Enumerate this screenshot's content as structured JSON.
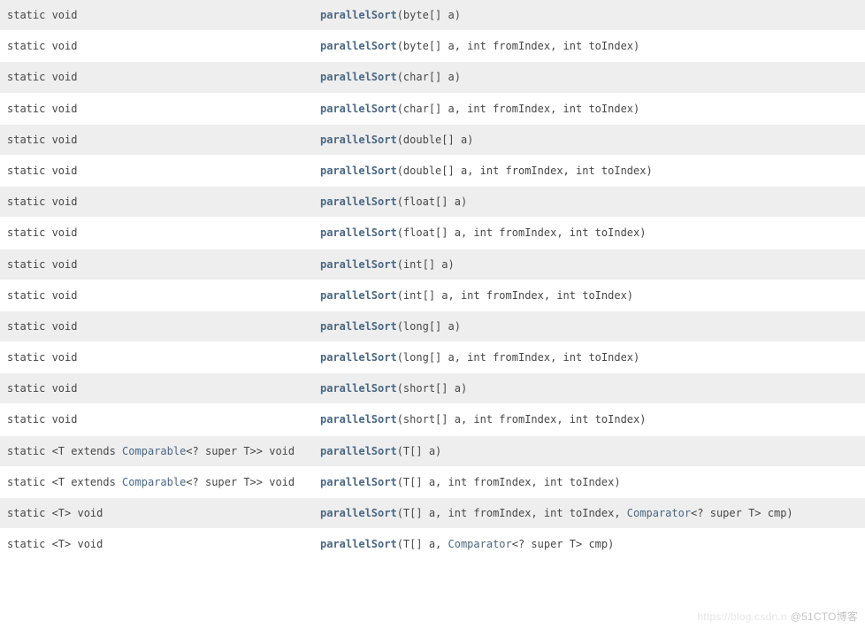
{
  "methods": [
    {
      "modifier_pre": "static void",
      "type_link": "",
      "modifier_post": "",
      "method": "parallelSort",
      "params_pre": "(byte[] a)",
      "params_link": "",
      "params_post": ""
    },
    {
      "modifier_pre": "static void",
      "type_link": "",
      "modifier_post": "",
      "method": "parallelSort",
      "params_pre": "(byte[] a, int fromIndex, int toIndex)",
      "params_link": "",
      "params_post": ""
    },
    {
      "modifier_pre": "static void",
      "type_link": "",
      "modifier_post": "",
      "method": "parallelSort",
      "params_pre": "(char[] a)",
      "params_link": "",
      "params_post": ""
    },
    {
      "modifier_pre": "static void",
      "type_link": "",
      "modifier_post": "",
      "method": "parallelSort",
      "params_pre": "(char[] a, int fromIndex, int toIndex)",
      "params_link": "",
      "params_post": ""
    },
    {
      "modifier_pre": "static void",
      "type_link": "",
      "modifier_post": "",
      "method": "parallelSort",
      "params_pre": "(double[] a)",
      "params_link": "",
      "params_post": ""
    },
    {
      "modifier_pre": "static void",
      "type_link": "",
      "modifier_post": "",
      "method": "parallelSort",
      "params_pre": "(double[] a, int fromIndex, int toIndex)",
      "params_link": "",
      "params_post": ""
    },
    {
      "modifier_pre": "static void",
      "type_link": "",
      "modifier_post": "",
      "method": "parallelSort",
      "params_pre": "(float[] a)",
      "params_link": "",
      "params_post": ""
    },
    {
      "modifier_pre": "static void",
      "type_link": "",
      "modifier_post": "",
      "method": "parallelSort",
      "params_pre": "(float[] a, int fromIndex, int toIndex)",
      "params_link": "",
      "params_post": ""
    },
    {
      "modifier_pre": "static void",
      "type_link": "",
      "modifier_post": "",
      "method": "parallelSort",
      "params_pre": "(int[] a)",
      "params_link": "",
      "params_post": ""
    },
    {
      "modifier_pre": "static void",
      "type_link": "",
      "modifier_post": "",
      "method": "parallelSort",
      "params_pre": "(int[] a, int fromIndex, int toIndex)",
      "params_link": "",
      "params_post": ""
    },
    {
      "modifier_pre": "static void",
      "type_link": "",
      "modifier_post": "",
      "method": "parallelSort",
      "params_pre": "(long[] a)",
      "params_link": "",
      "params_post": ""
    },
    {
      "modifier_pre": "static void",
      "type_link": "",
      "modifier_post": "",
      "method": "parallelSort",
      "params_pre": "(long[] a, int fromIndex, int toIndex)",
      "params_link": "",
      "params_post": ""
    },
    {
      "modifier_pre": "static void",
      "type_link": "",
      "modifier_post": "",
      "method": "parallelSort",
      "params_pre": "(short[] a)",
      "params_link": "",
      "params_post": ""
    },
    {
      "modifier_pre": "static void",
      "type_link": "",
      "modifier_post": "",
      "method": "parallelSort",
      "params_pre": "(short[] a, int fromIndex, int toIndex)",
      "params_link": "",
      "params_post": ""
    },
    {
      "modifier_pre": "static <T extends ",
      "type_link": "Comparable",
      "modifier_post": "<? super T>> void",
      "method": "parallelSort",
      "params_pre": "(T[] a)",
      "params_link": "",
      "params_post": ""
    },
    {
      "modifier_pre": "static <T extends ",
      "type_link": "Comparable",
      "modifier_post": "<? super T>> void",
      "method": "parallelSort",
      "params_pre": "(T[] a, int fromIndex, int toIndex)",
      "params_link": "",
      "params_post": ""
    },
    {
      "modifier_pre": "static <T> void",
      "type_link": "",
      "modifier_post": "",
      "method": "parallelSort",
      "params_pre": "(T[] a, int fromIndex, int toIndex, ",
      "params_link": "Comparator",
      "params_post": "<? super T> cmp)"
    },
    {
      "modifier_pre": "static <T> void",
      "type_link": "",
      "modifier_post": "",
      "method": "parallelSort",
      "params_pre": "(T[] a, ",
      "params_link": "Comparator",
      "params_post": "<? super T> cmp)"
    }
  ],
  "watermark": {
    "faint": "https://blog.csdn.n",
    "main": "@51CTO博客"
  }
}
